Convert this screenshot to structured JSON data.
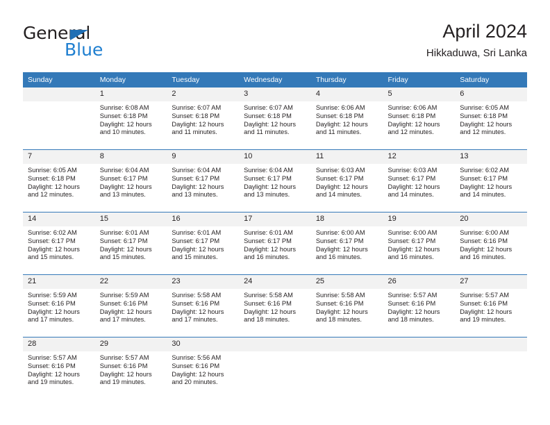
{
  "logo": {
    "word1": "General",
    "word2": "Blue",
    "triangle_color": "#1f6fb5",
    "blue_color": "#1f7fd0"
  },
  "header": {
    "title": "April 2024",
    "subtitle": "Hikkaduwa, Sri Lanka"
  },
  "theme": {
    "header_bar": "#3479b8",
    "daynum_bg": "#f2f2f2",
    "text": "#231f20"
  },
  "calendar": {
    "weekday_headers": [
      "Sunday",
      "Monday",
      "Tuesday",
      "Wednesday",
      "Thursday",
      "Friday",
      "Saturday"
    ],
    "weeks": [
      [
        {
          "day": "",
          "empty": true,
          "sunrise": "",
          "sunset": "",
          "daylight1": "",
          "daylight2": ""
        },
        {
          "day": "1",
          "sunrise": "Sunrise: 6:08 AM",
          "sunset": "Sunset: 6:18 PM",
          "daylight1": "Daylight: 12 hours",
          "daylight2": "and 10 minutes."
        },
        {
          "day": "2",
          "sunrise": "Sunrise: 6:07 AM",
          "sunset": "Sunset: 6:18 PM",
          "daylight1": "Daylight: 12 hours",
          "daylight2": "and 11 minutes."
        },
        {
          "day": "3",
          "sunrise": "Sunrise: 6:07 AM",
          "sunset": "Sunset: 6:18 PM",
          "daylight1": "Daylight: 12 hours",
          "daylight2": "and 11 minutes."
        },
        {
          "day": "4",
          "sunrise": "Sunrise: 6:06 AM",
          "sunset": "Sunset: 6:18 PM",
          "daylight1": "Daylight: 12 hours",
          "daylight2": "and 11 minutes."
        },
        {
          "day": "5",
          "sunrise": "Sunrise: 6:06 AM",
          "sunset": "Sunset: 6:18 PM",
          "daylight1": "Daylight: 12 hours",
          "daylight2": "and 12 minutes."
        },
        {
          "day": "6",
          "sunrise": "Sunrise: 6:05 AM",
          "sunset": "Sunset: 6:18 PM",
          "daylight1": "Daylight: 12 hours",
          "daylight2": "and 12 minutes."
        }
      ],
      [
        {
          "day": "7",
          "sunrise": "Sunrise: 6:05 AM",
          "sunset": "Sunset: 6:18 PM",
          "daylight1": "Daylight: 12 hours",
          "daylight2": "and 12 minutes."
        },
        {
          "day": "8",
          "sunrise": "Sunrise: 6:04 AM",
          "sunset": "Sunset: 6:17 PM",
          "daylight1": "Daylight: 12 hours",
          "daylight2": "and 13 minutes."
        },
        {
          "day": "9",
          "sunrise": "Sunrise: 6:04 AM",
          "sunset": "Sunset: 6:17 PM",
          "daylight1": "Daylight: 12 hours",
          "daylight2": "and 13 minutes."
        },
        {
          "day": "10",
          "sunrise": "Sunrise: 6:04 AM",
          "sunset": "Sunset: 6:17 PM",
          "daylight1": "Daylight: 12 hours",
          "daylight2": "and 13 minutes."
        },
        {
          "day": "11",
          "sunrise": "Sunrise: 6:03 AM",
          "sunset": "Sunset: 6:17 PM",
          "daylight1": "Daylight: 12 hours",
          "daylight2": "and 14 minutes."
        },
        {
          "day": "12",
          "sunrise": "Sunrise: 6:03 AM",
          "sunset": "Sunset: 6:17 PM",
          "daylight1": "Daylight: 12 hours",
          "daylight2": "and 14 minutes."
        },
        {
          "day": "13",
          "sunrise": "Sunrise: 6:02 AM",
          "sunset": "Sunset: 6:17 PM",
          "daylight1": "Daylight: 12 hours",
          "daylight2": "and 14 minutes."
        }
      ],
      [
        {
          "day": "14",
          "sunrise": "Sunrise: 6:02 AM",
          "sunset": "Sunset: 6:17 PM",
          "daylight1": "Daylight: 12 hours",
          "daylight2": "and 15 minutes."
        },
        {
          "day": "15",
          "sunrise": "Sunrise: 6:01 AM",
          "sunset": "Sunset: 6:17 PM",
          "daylight1": "Daylight: 12 hours",
          "daylight2": "and 15 minutes."
        },
        {
          "day": "16",
          "sunrise": "Sunrise: 6:01 AM",
          "sunset": "Sunset: 6:17 PM",
          "daylight1": "Daylight: 12 hours",
          "daylight2": "and 15 minutes."
        },
        {
          "day": "17",
          "sunrise": "Sunrise: 6:01 AM",
          "sunset": "Sunset: 6:17 PM",
          "daylight1": "Daylight: 12 hours",
          "daylight2": "and 16 minutes."
        },
        {
          "day": "18",
          "sunrise": "Sunrise: 6:00 AM",
          "sunset": "Sunset: 6:17 PM",
          "daylight1": "Daylight: 12 hours",
          "daylight2": "and 16 minutes."
        },
        {
          "day": "19",
          "sunrise": "Sunrise: 6:00 AM",
          "sunset": "Sunset: 6:17 PM",
          "daylight1": "Daylight: 12 hours",
          "daylight2": "and 16 minutes."
        },
        {
          "day": "20",
          "sunrise": "Sunrise: 6:00 AM",
          "sunset": "Sunset: 6:16 PM",
          "daylight1": "Daylight: 12 hours",
          "daylight2": "and 16 minutes."
        }
      ],
      [
        {
          "day": "21",
          "sunrise": "Sunrise: 5:59 AM",
          "sunset": "Sunset: 6:16 PM",
          "daylight1": "Daylight: 12 hours",
          "daylight2": "and 17 minutes."
        },
        {
          "day": "22",
          "sunrise": "Sunrise: 5:59 AM",
          "sunset": "Sunset: 6:16 PM",
          "daylight1": "Daylight: 12 hours",
          "daylight2": "and 17 minutes."
        },
        {
          "day": "23",
          "sunrise": "Sunrise: 5:58 AM",
          "sunset": "Sunset: 6:16 PM",
          "daylight1": "Daylight: 12 hours",
          "daylight2": "and 17 minutes."
        },
        {
          "day": "24",
          "sunrise": "Sunrise: 5:58 AM",
          "sunset": "Sunset: 6:16 PM",
          "daylight1": "Daylight: 12 hours",
          "daylight2": "and 18 minutes."
        },
        {
          "day": "25",
          "sunrise": "Sunrise: 5:58 AM",
          "sunset": "Sunset: 6:16 PM",
          "daylight1": "Daylight: 12 hours",
          "daylight2": "and 18 minutes."
        },
        {
          "day": "26",
          "sunrise": "Sunrise: 5:57 AM",
          "sunset": "Sunset: 6:16 PM",
          "daylight1": "Daylight: 12 hours",
          "daylight2": "and 18 minutes."
        },
        {
          "day": "27",
          "sunrise": "Sunrise: 5:57 AM",
          "sunset": "Sunset: 6:16 PM",
          "daylight1": "Daylight: 12 hours",
          "daylight2": "and 19 minutes."
        }
      ],
      [
        {
          "day": "28",
          "sunrise": "Sunrise: 5:57 AM",
          "sunset": "Sunset: 6:16 PM",
          "daylight1": "Daylight: 12 hours",
          "daylight2": "and 19 minutes."
        },
        {
          "day": "29",
          "sunrise": "Sunrise: 5:57 AM",
          "sunset": "Sunset: 6:16 PM",
          "daylight1": "Daylight: 12 hours",
          "daylight2": "and 19 minutes."
        },
        {
          "day": "30",
          "sunrise": "Sunrise: 5:56 AM",
          "sunset": "Sunset: 6:16 PM",
          "daylight1": "Daylight: 12 hours",
          "daylight2": "and 20 minutes."
        },
        {
          "day": "",
          "empty": true,
          "sunrise": "",
          "sunset": "",
          "daylight1": "",
          "daylight2": ""
        },
        {
          "day": "",
          "empty": true,
          "sunrise": "",
          "sunset": "",
          "daylight1": "",
          "daylight2": ""
        },
        {
          "day": "",
          "empty": true,
          "sunrise": "",
          "sunset": "",
          "daylight1": "",
          "daylight2": ""
        },
        {
          "day": "",
          "empty": true,
          "sunrise": "",
          "sunset": "",
          "daylight1": "",
          "daylight2": ""
        }
      ]
    ]
  }
}
